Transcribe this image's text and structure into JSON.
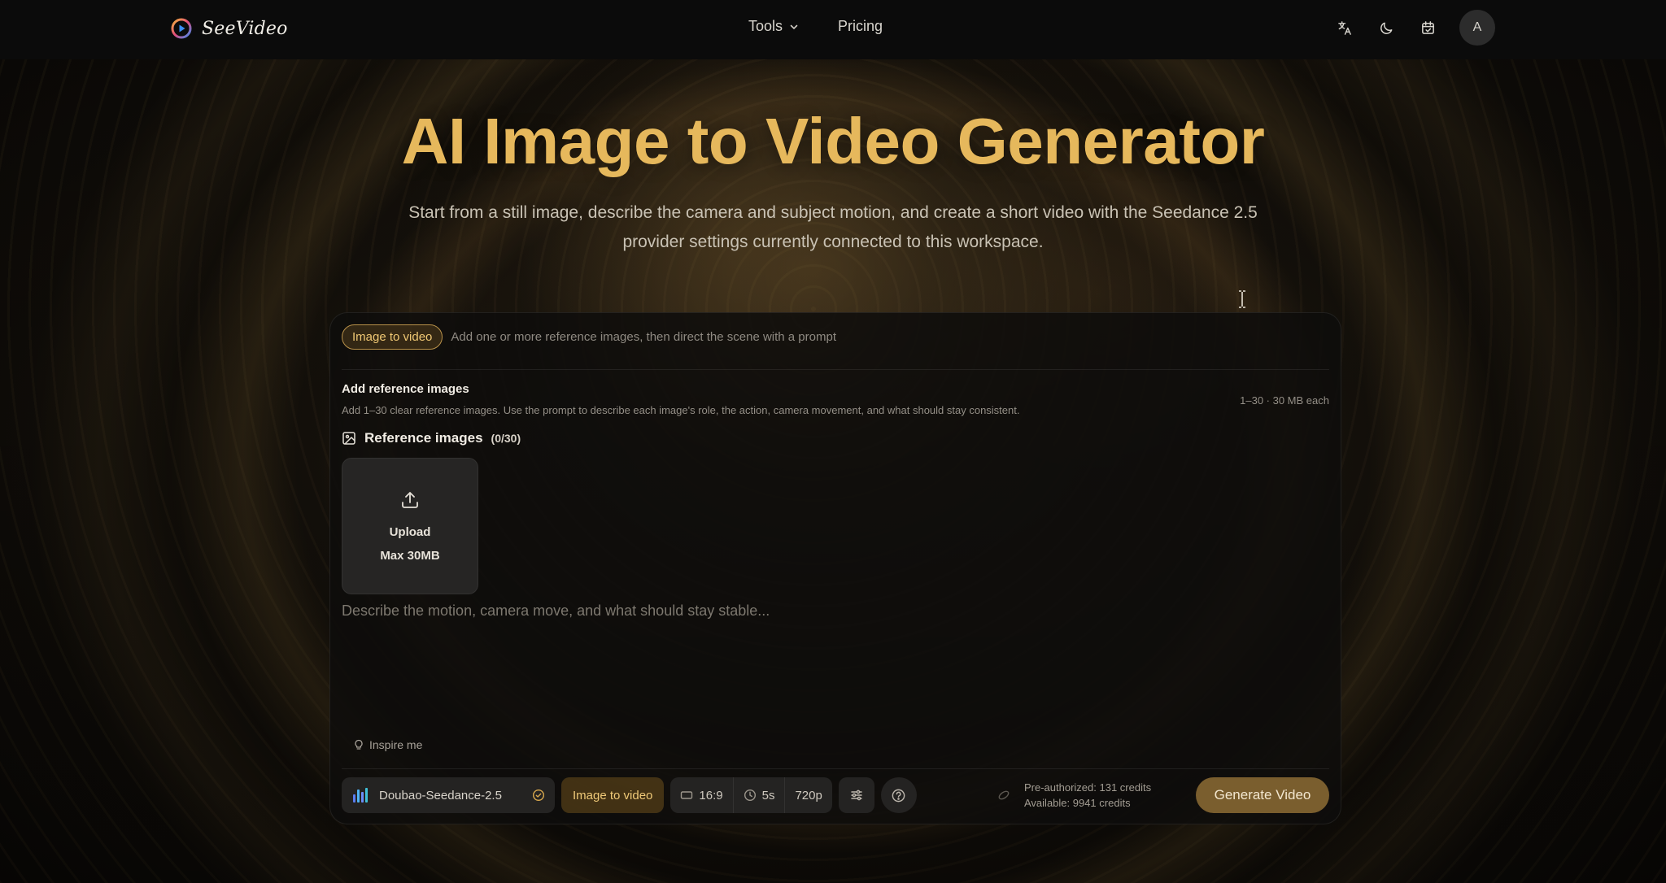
{
  "brand": {
    "name": "SeeVideo",
    "logo_icon": "play-circle-logo"
  },
  "nav": {
    "tools": "Tools",
    "pricing": "Pricing"
  },
  "header_icons": [
    "translate-icon",
    "moon-icon",
    "calendar-icon"
  ],
  "avatar": {
    "initial": "A"
  },
  "hero": {
    "title": "AI Image to Video Generator",
    "subtitle": "Start from a still image, describe the camera and subject motion, and create a short video with the Seedance 2.5 provider settings currently connected to this workspace."
  },
  "panel": {
    "mode_label": "Image to video",
    "mode_desc": "Add one or more reference images, then direct the scene with a prompt",
    "ref_title": "Add reference images",
    "ref_desc": "Add 1–30 clear reference images. Use the prompt to describe each image's role, the action, camera movement, and what should stay consistent.",
    "ref_limit": "1–30 · 30 MB each",
    "ref_heading": "Reference images",
    "ref_count": "(0/30)",
    "upload_label": "Upload",
    "upload_max": "Max 30MB",
    "prompt_placeholder": "Describe the motion, camera move, and what should stay stable...",
    "inspire": "Inspire me"
  },
  "toolbar": {
    "model": "Doubao-Seedance-2.5",
    "mode": "Image to video",
    "aspect": "16:9",
    "duration": "5s",
    "resolution": "720p"
  },
  "credits": {
    "preauthorized": "Pre-authorized: 131 credits",
    "available": "Available: 9941 credits"
  },
  "generate": "Generate Video",
  "colors": {
    "accent": "#e6b85c",
    "button": "#7a5e2e",
    "panel": "#0e0d0c"
  }
}
